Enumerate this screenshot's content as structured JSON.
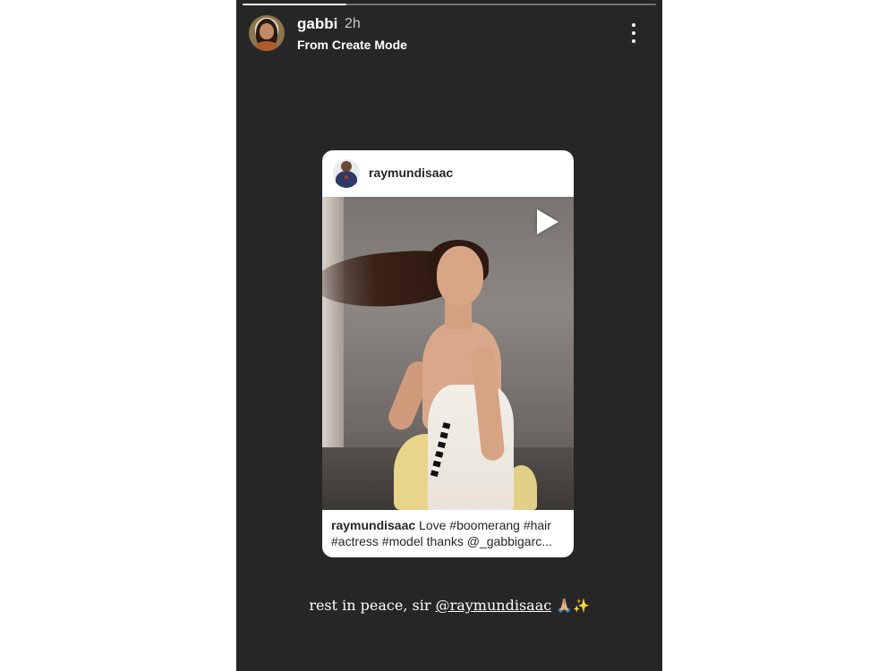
{
  "story": {
    "progress": 0.25,
    "username": "gabbi",
    "time": "2h",
    "subtitle": "From Create Mode",
    "more_icon": "more-vertical-icon"
  },
  "shared_post": {
    "username": "raymundisaac",
    "play_icon": "play-icon",
    "caption_user": "raymundisaac",
    "caption_line1": " Love #boomerang #hair",
    "caption_line2": "#actress #model thanks @_gabbigarc..."
  },
  "story_caption": {
    "text_before": "rest in peace, sir ",
    "mention": "@raymundisaac",
    "emoji_pray": "🙏🏼",
    "emoji_sparkles": "✨"
  },
  "colors": {
    "story_background": "#262626",
    "card_background": "#ffffff",
    "text_light": "#ffffff",
    "text_dark": "#262626"
  }
}
